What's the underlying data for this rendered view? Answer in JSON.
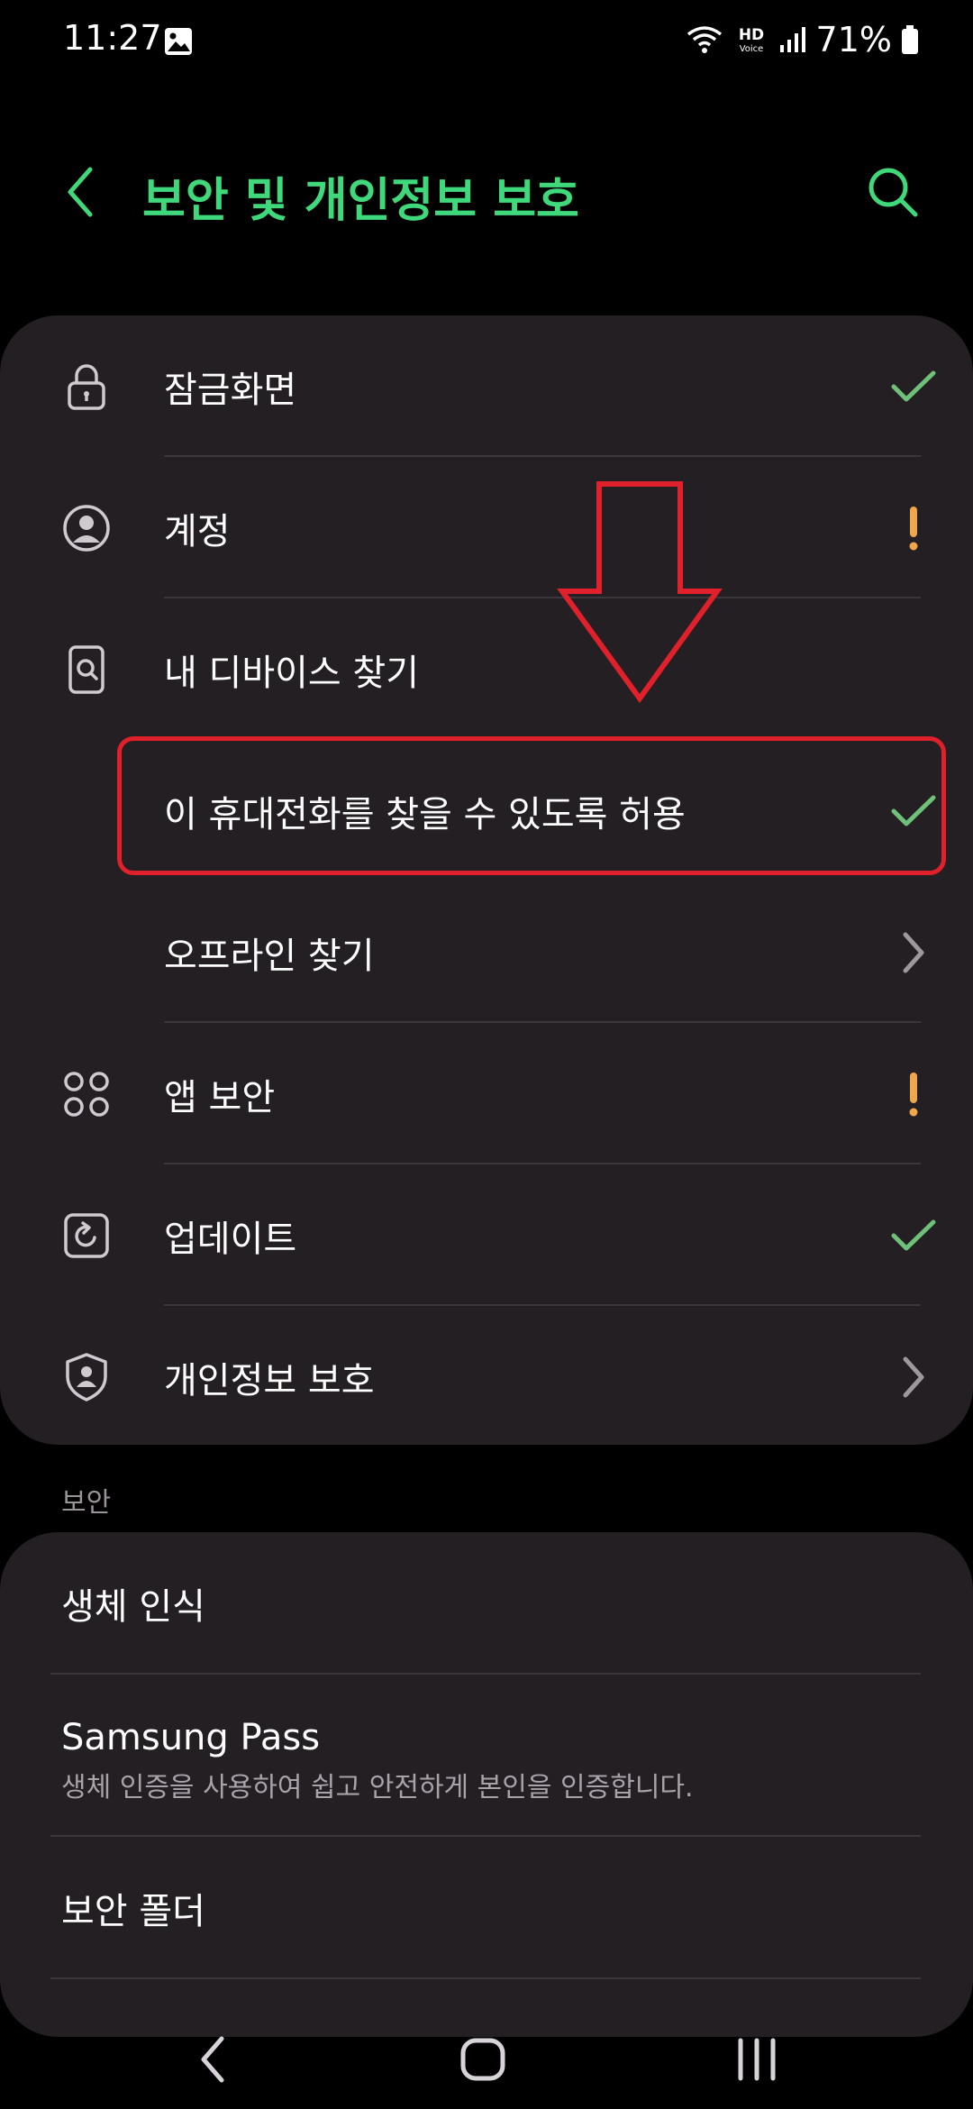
{
  "status_bar": {
    "time": "11:27",
    "battery": "71%",
    "hd_top": "HD",
    "hd_bottom": "Voice"
  },
  "header": {
    "title": "보안 및 개인정보 보호"
  },
  "main_items": [
    {
      "label": "잠금화면",
      "icon": "lock-icon",
      "status": "check"
    },
    {
      "label": "계정",
      "icon": "account-icon",
      "status": "warning"
    },
    {
      "label": "내 디바이스 찾기",
      "icon": "find-device-icon",
      "status": "none"
    },
    {
      "label": "이 휴대전화를 찾을 수 있도록 허용",
      "icon": "none",
      "status": "check"
    },
    {
      "label": "오프라인 찾기",
      "icon": "none",
      "status": "chevron"
    },
    {
      "label": "앱 보안",
      "icon": "app-security-icon",
      "status": "warning"
    },
    {
      "label": "업데이트",
      "icon": "update-icon",
      "status": "check"
    },
    {
      "label": "개인정보 보호",
      "icon": "privacy-shield-icon",
      "status": "chevron"
    }
  ],
  "security_section": {
    "header": "보안",
    "items": [
      {
        "label": "생체 인식"
      },
      {
        "label": "Samsung Pass",
        "sub": "생체 인증을 사용하여 쉽고 안전하게 본인을 인증합니다."
      },
      {
        "label": "보안 폴더"
      }
    ]
  },
  "colors": {
    "accent": "#3fd87a",
    "check": "#6fc17a",
    "warning": "#f0a64a",
    "annotation": "#e0202a"
  }
}
